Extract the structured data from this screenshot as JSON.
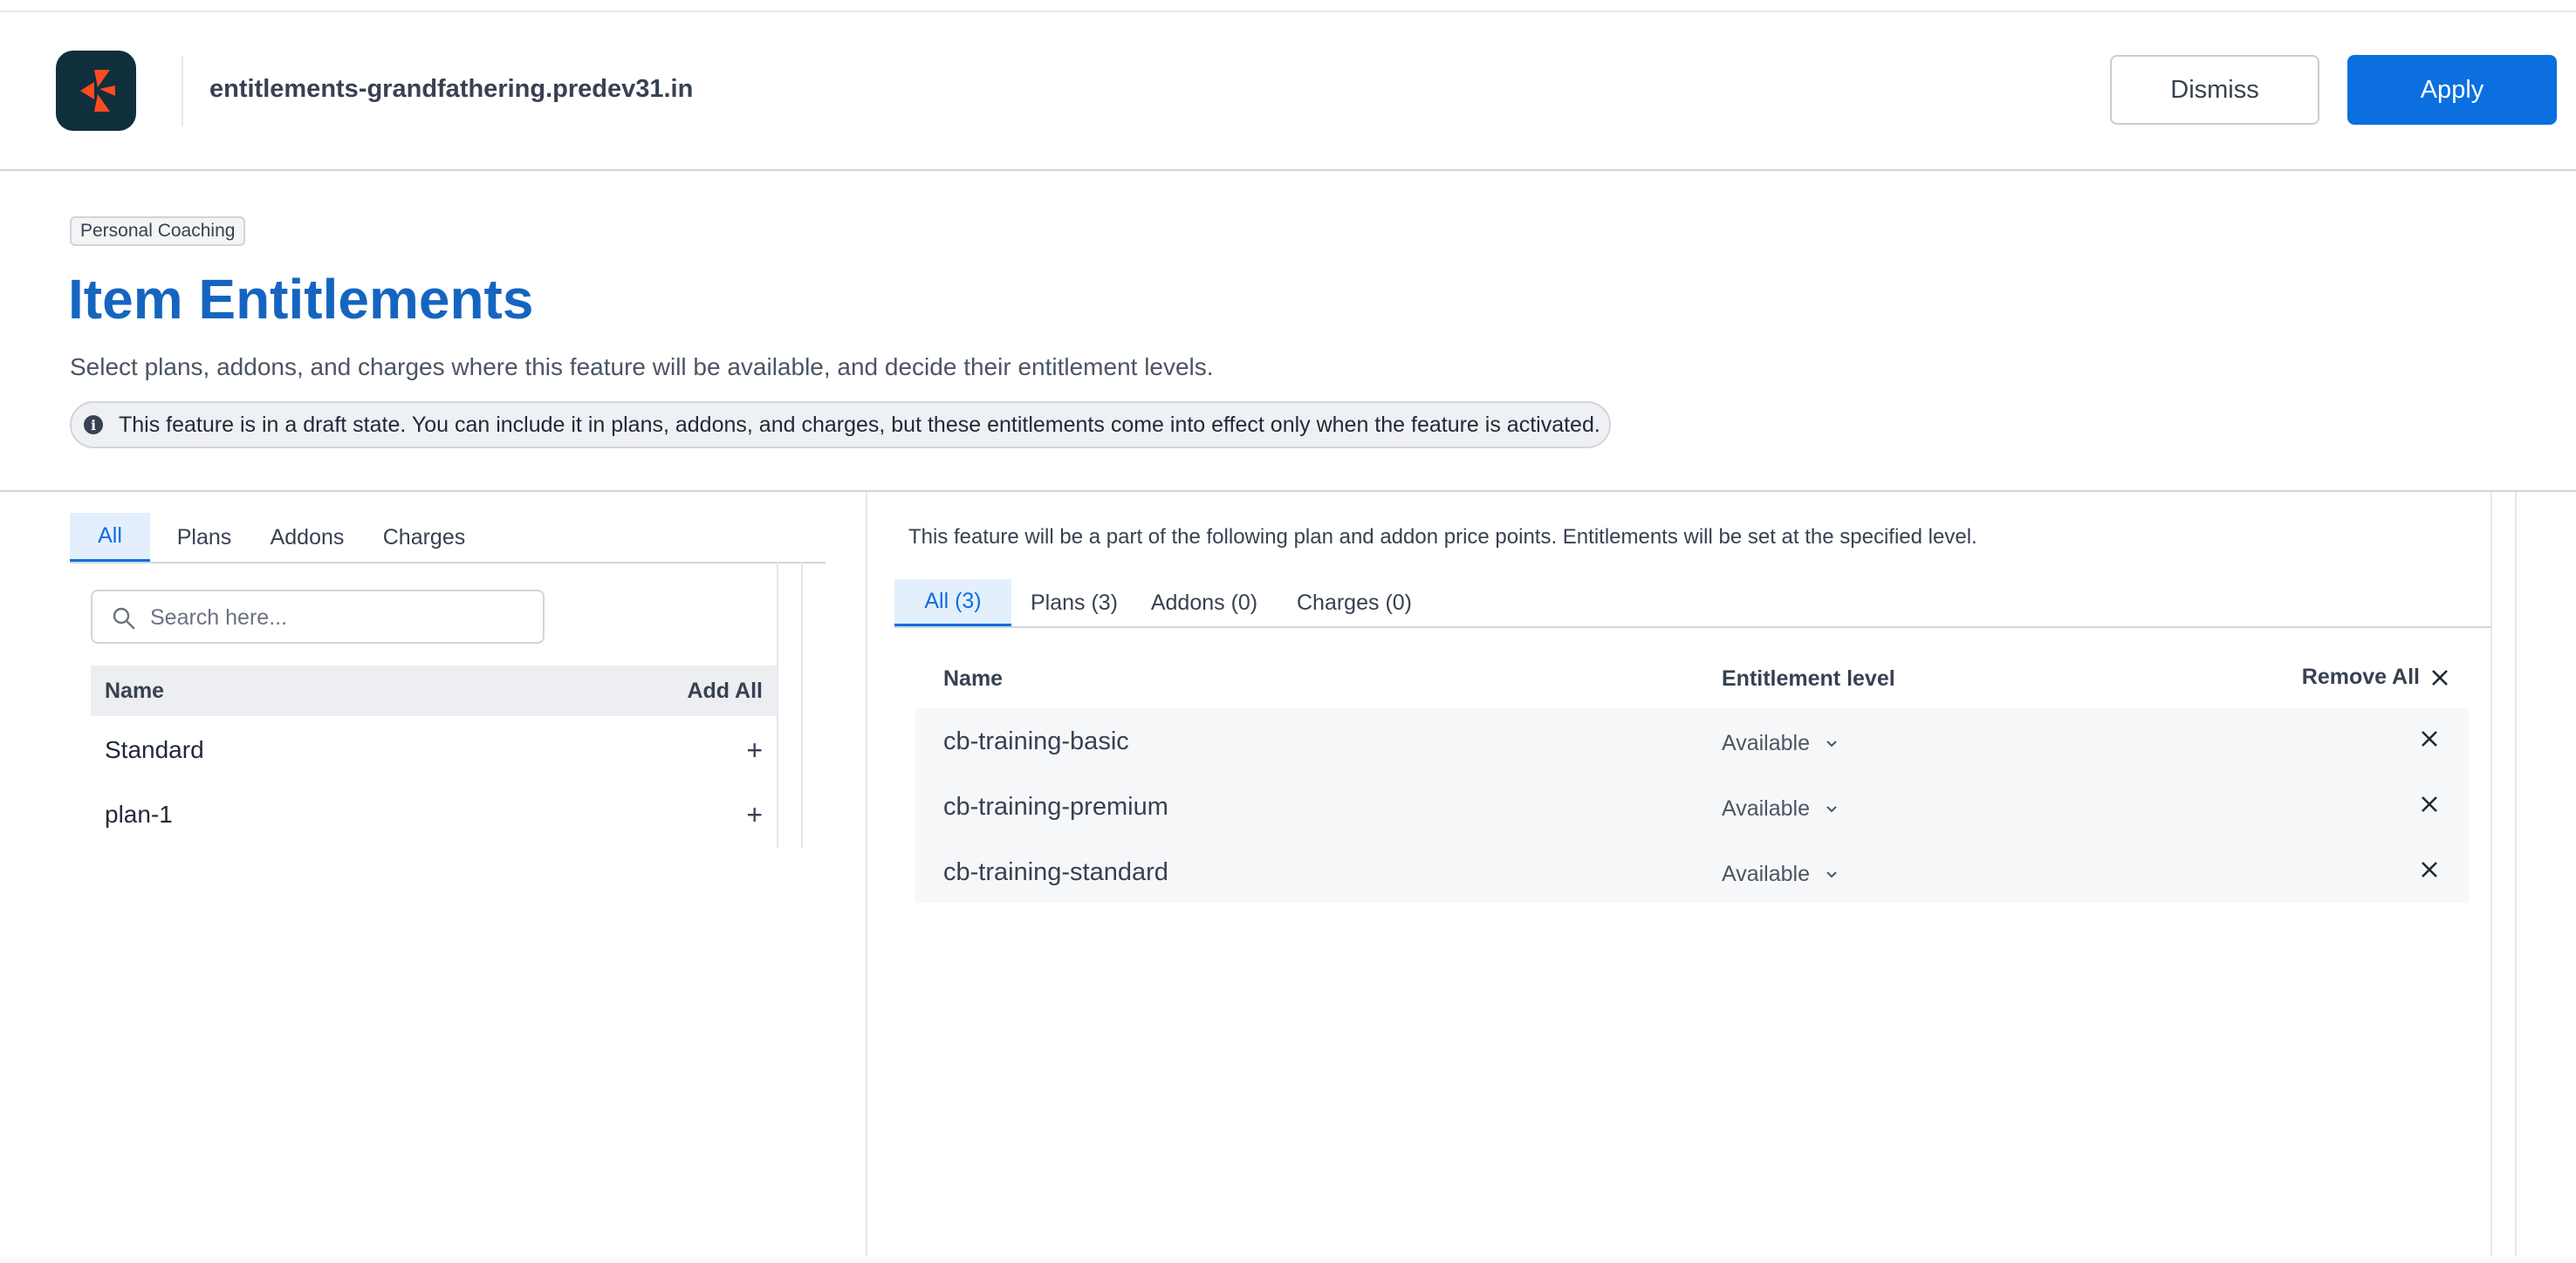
{
  "header": {
    "site_name": "entitlements-grandfathering.predev31.in",
    "dismiss_label": "Dismiss",
    "apply_label": "Apply",
    "accent_color": "#0b6fe0"
  },
  "page": {
    "feature_badge": "Personal Coaching",
    "title": "Item Entitlements",
    "subtitle": "Select plans, addons, and charges where this feature will be available, and decide their entitlement levels.",
    "draft_notice": "This feature is in a draft state. You can include it in plans, addons, and charges, but these entitlements come into effect only when the feature is activated."
  },
  "left_panel": {
    "tabs": [
      {
        "label": "All",
        "active": true
      },
      {
        "label": "Plans",
        "active": false
      },
      {
        "label": "Addons",
        "active": false
      },
      {
        "label": "Charges",
        "active": false
      }
    ],
    "search": {
      "placeholder": "Search here...",
      "value": ""
    },
    "columns": {
      "name": "Name",
      "add_all": "Add All"
    },
    "items": [
      {
        "name": "Standard",
        "action_icon": "plus-icon"
      },
      {
        "name": "plan-1",
        "action_icon": "plus-icon"
      }
    ]
  },
  "right_panel": {
    "note": "This feature will be a part of the following plan and addon price points. Entitlements will be set at the specified level.",
    "tabs": [
      {
        "label": "All (3)",
        "active": true
      },
      {
        "label": "Plans (3)",
        "active": false
      },
      {
        "label": "Addons (0)",
        "active": false
      },
      {
        "label": "Charges (0)",
        "active": false
      }
    ],
    "columns": {
      "name": "Name",
      "level": "Entitlement level",
      "remove_all": "Remove All"
    },
    "rows": [
      {
        "name": "cb-training-basic",
        "level": "Available"
      },
      {
        "name": "cb-training-premium",
        "level": "Available"
      },
      {
        "name": "cb-training-standard",
        "level": "Available"
      }
    ]
  }
}
